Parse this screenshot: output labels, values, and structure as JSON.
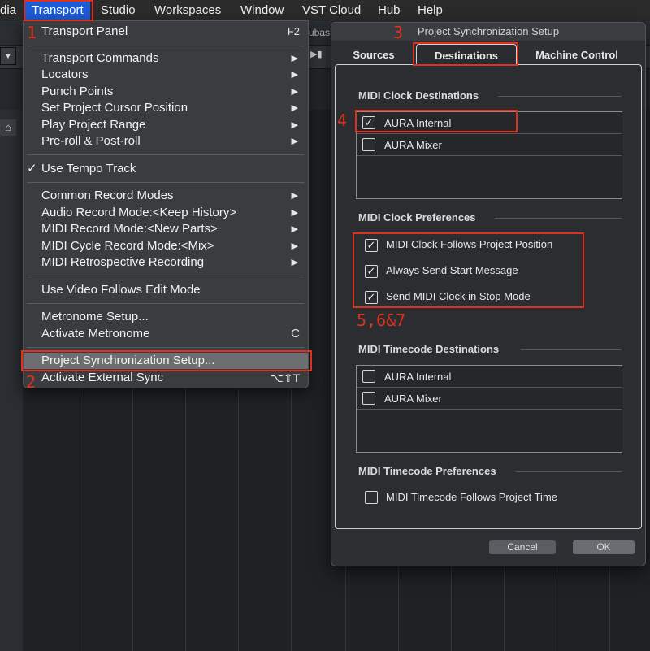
{
  "menubar": {
    "items": [
      {
        "label": "dia"
      },
      {
        "label": "Transport"
      },
      {
        "label": "Studio"
      },
      {
        "label": "Workspaces"
      },
      {
        "label": "Window"
      },
      {
        "label": "VST Cloud"
      },
      {
        "label": "Hub"
      },
      {
        "label": "Help"
      }
    ]
  },
  "background": {
    "app_label_fragment": "ubas"
  },
  "transport_menu": {
    "items": [
      {
        "label": "Transport Panel",
        "shortcut": "F2"
      },
      {
        "label": "Transport Commands"
      },
      {
        "label": "Locators"
      },
      {
        "label": "Punch Points"
      },
      {
        "label": "Set Project Cursor Position"
      },
      {
        "label": "Play Project Range"
      },
      {
        "label": "Pre-roll & Post-roll"
      },
      {
        "label": "Use Tempo Track",
        "check": "✓"
      },
      {
        "label": "Common Record Modes"
      },
      {
        "label": "Audio Record Mode:<Keep History>"
      },
      {
        "label": "MIDI Record Mode:<New Parts>"
      },
      {
        "label": "MIDI Cycle Record Mode:<Mix>"
      },
      {
        "label": "MIDI Retrospective Recording"
      },
      {
        "label": "Use Video Follows Edit Mode"
      },
      {
        "label": "Metronome Setup..."
      },
      {
        "label": "Activate Metronome",
        "shortcut": "C"
      },
      {
        "label": "Project Synchronization Setup..."
      },
      {
        "label": "Activate External Sync",
        "shortcut": "⌥⇧T"
      }
    ]
  },
  "dialog": {
    "title": "Project Synchronization Setup",
    "tabs": [
      {
        "label": "Sources"
      },
      {
        "label": "Destinations"
      },
      {
        "label": "Machine Control"
      }
    ],
    "midi_clock_destinations": {
      "title": "MIDI Clock Destinations",
      "items": [
        {
          "label": "AURA Internal",
          "checked": "✓"
        },
        {
          "label": "AURA Mixer",
          "checked": ""
        }
      ]
    },
    "midi_clock_preferences": {
      "title": "MIDI Clock Preferences",
      "items": [
        {
          "label": "MIDI Clock Follows Project Position",
          "checked": "✓"
        },
        {
          "label": "Always Send Start Message",
          "checked": "✓"
        },
        {
          "label": "Send MIDI Clock in Stop Mode",
          "checked": "✓"
        }
      ]
    },
    "midi_timecode_destinations": {
      "title": "MIDI Timecode Destinations",
      "items": [
        {
          "label": "AURA Internal",
          "checked": ""
        },
        {
          "label": "AURA Mixer",
          "checked": ""
        }
      ]
    },
    "midi_timecode_preferences": {
      "title": "MIDI Timecode Preferences",
      "items": [
        {
          "label": "MIDI Timecode Follows Project Time",
          "checked": ""
        }
      ]
    },
    "buttons": {
      "cancel": "Cancel",
      "ok": "OK"
    }
  },
  "annotations": {
    "n1": "1",
    "n2": "2",
    "n3": "3",
    "n4": "4",
    "n567": "5,6&7",
    "color": "#e0301e"
  }
}
